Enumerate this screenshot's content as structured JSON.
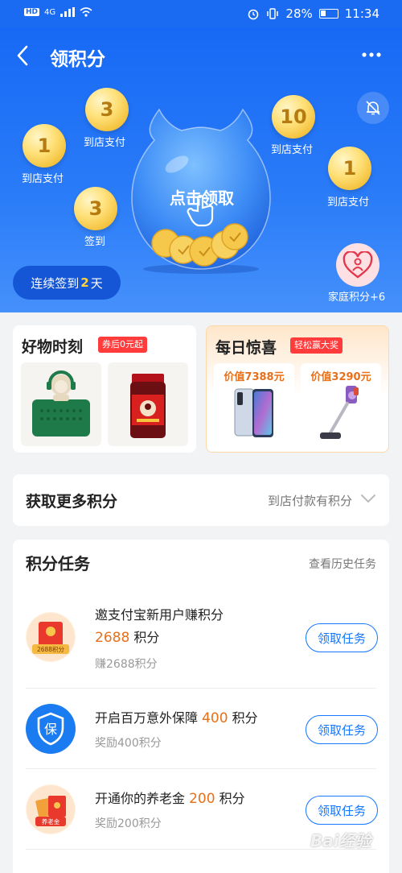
{
  "status_bar": {
    "hd": "HD",
    "network": "4G",
    "battery": "28%",
    "time": "11:34"
  },
  "header": {
    "title": "领积分"
  },
  "hero": {
    "coins": [
      {
        "value": "1",
        "label": "到店支付"
      },
      {
        "value": "3",
        "label": "到店支付"
      },
      {
        "value": "3",
        "label": "签到"
      },
      {
        "value": "10",
        "label": "到店支付"
      },
      {
        "value": "1",
        "label": "到店支付"
      }
    ],
    "claim_text": "点击领取",
    "streak": {
      "prefix": "连续签到",
      "days": "2",
      "suffix": "天"
    },
    "family_label": "家庭积分+6"
  },
  "promo": {
    "left": {
      "title": "好物时刻",
      "tag": "券后0元起"
    },
    "right": {
      "title": "每日惊喜",
      "tag": "轻松赢大奖",
      "prices": [
        "价值7388元",
        "价值3290元"
      ]
    }
  },
  "more_points": {
    "title": "获取更多积分",
    "subtitle": "到店付款有积分"
  },
  "tasks": {
    "title": "积分任务",
    "history": "查看历史任务",
    "button_label": "领取任务",
    "items": [
      {
        "title": "邀支付宝新用户赚积分",
        "points": "2688",
        "points_unit": "积分",
        "sub": "赚2688积分",
        "icon_text": "2688积分"
      },
      {
        "title_prefix": "开启百万意外保障",
        "points": "400",
        "points_unit": "积分",
        "sub": "奖励400积分",
        "icon_text": "保"
      },
      {
        "title_prefix": "开通你的养老金",
        "points": "200",
        "points_unit": "积分",
        "sub": "奖励200积分",
        "icon_text": "养老金"
      }
    ]
  },
  "watermark": "Bai经验"
}
